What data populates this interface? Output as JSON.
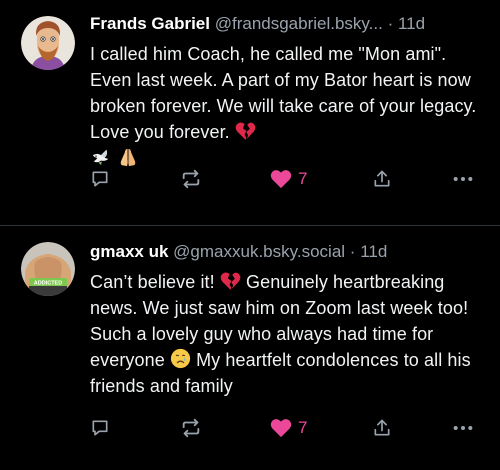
{
  "posts": [
    {
      "display_name": "Frands Gabriel",
      "handle": "@frandsgabriel.bsky...",
      "separator": "·",
      "time": "11d",
      "text": "I called him Coach, he called me \"Mon ami\". Even last week. A part of my Bator heart is now broken forever. We will take care of your legacy. Love you forever.",
      "trailing_emojis": [
        "broken-heart-emoji",
        "dove-emoji",
        "folded-hands-emoji"
      ],
      "like_count": "7"
    },
    {
      "display_name": "gmaxx uk",
      "handle": "@gmaxxuk.bsky.social",
      "separator": "·",
      "time": "11d",
      "text_part1": "Can’t believe it!",
      "text_part2": "Genuinely heartbreaking news. We just saw him on Zoom last week too! Such a lovely guy who always had time for everyone",
      "text_part3": "My heartfelt condolences to all his friends and family",
      "avatar_badge": "ADDICTED",
      "like_count": "7"
    }
  ],
  "colors": {
    "background": "#000000",
    "text": "#f1f3f5",
    "muted": "#9aa3ad",
    "like": "#ec4899",
    "divider": "#2e3338"
  },
  "icons": [
    "reply-icon",
    "repost-icon",
    "heart-icon",
    "share-icon",
    "more-icon"
  ]
}
